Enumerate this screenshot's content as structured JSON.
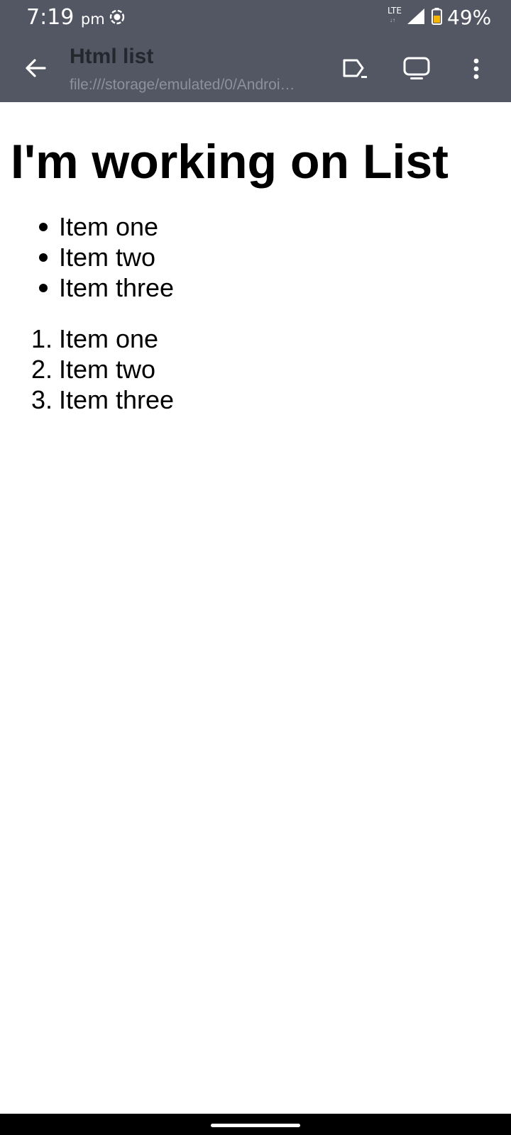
{
  "status_bar": {
    "time": "7:19",
    "ampm": "pm",
    "network": "LTE",
    "network_arrows": "↓↑",
    "battery": "49%",
    "battery_color": "#f5b400"
  },
  "toolbar": {
    "title": "Html list",
    "url": "file:///storage/emulated/0/Androi…",
    "background": "#535764",
    "icons": [
      "back-arrow-icon",
      "open-in-browser-icon",
      "cast-icon",
      "more-vert-icon"
    ]
  },
  "page": {
    "heading": "I'm working on List",
    "unordered_list": [
      "Item one",
      "Item two",
      "Item three"
    ],
    "ordered_list": {
      "numbers": [
        "1.",
        "2.",
        "3."
      ],
      "items": [
        "Item one",
        "Item two",
        "Item three"
      ]
    }
  }
}
